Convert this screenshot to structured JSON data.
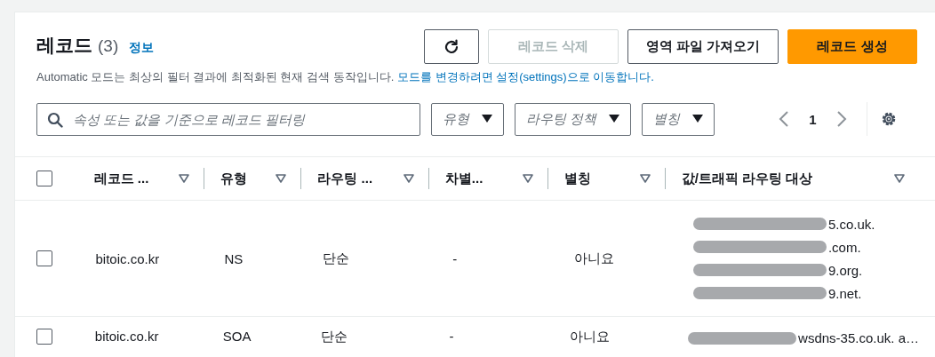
{
  "header": {
    "title": "레코드",
    "count": "(3)",
    "info_link": "정보",
    "description": "Automatic 모드는 최상의 필터 결과에 최적화된 현재 검색 동작입니다.",
    "description_link": "모드를 변경하려면 설정(settings)으로 이동합니다."
  },
  "buttons": [
    {
      "kind": "icon",
      "disabled": false
    },
    {
      "kind": "normal",
      "label": "레코드 삭제",
      "disabled": true
    },
    {
      "kind": "normal",
      "label": "영역 파일 가져오기",
      "disabled": false
    },
    {
      "kind": "primary",
      "label": "레코드 생성",
      "disabled": false
    }
  ],
  "search": {
    "placeholder": "속성 또는 값을 기준으로 레코드 필터링"
  },
  "filters": [
    {
      "label": "유형"
    },
    {
      "label": "라우팅 정책"
    },
    {
      "label": "별칭"
    }
  ],
  "pagination": {
    "page": "1"
  },
  "table": {
    "select_all": false,
    "columns": [
      "레코드 ...",
      "유형",
      "라우팅 ...",
      "차별...",
      "별칭",
      "값/트래픽 라우팅 대상"
    ],
    "rows": [
      {
        "checked": false,
        "cells": [
          "bitoic.co.kr",
          "NS",
          "단순",
          "-",
          "아니요"
        ],
        "values": [
          "5.co.uk.",
          ".com.",
          "9.org.",
          "9.net."
        ]
      },
      {
        "checked": false,
        "cells": [
          "bitoic.co.kr",
          "SOA",
          "단순",
          "-",
          "아니요"
        ],
        "values": [
          "wsdns-35.co.uk. a…"
        ]
      }
    ]
  }
}
